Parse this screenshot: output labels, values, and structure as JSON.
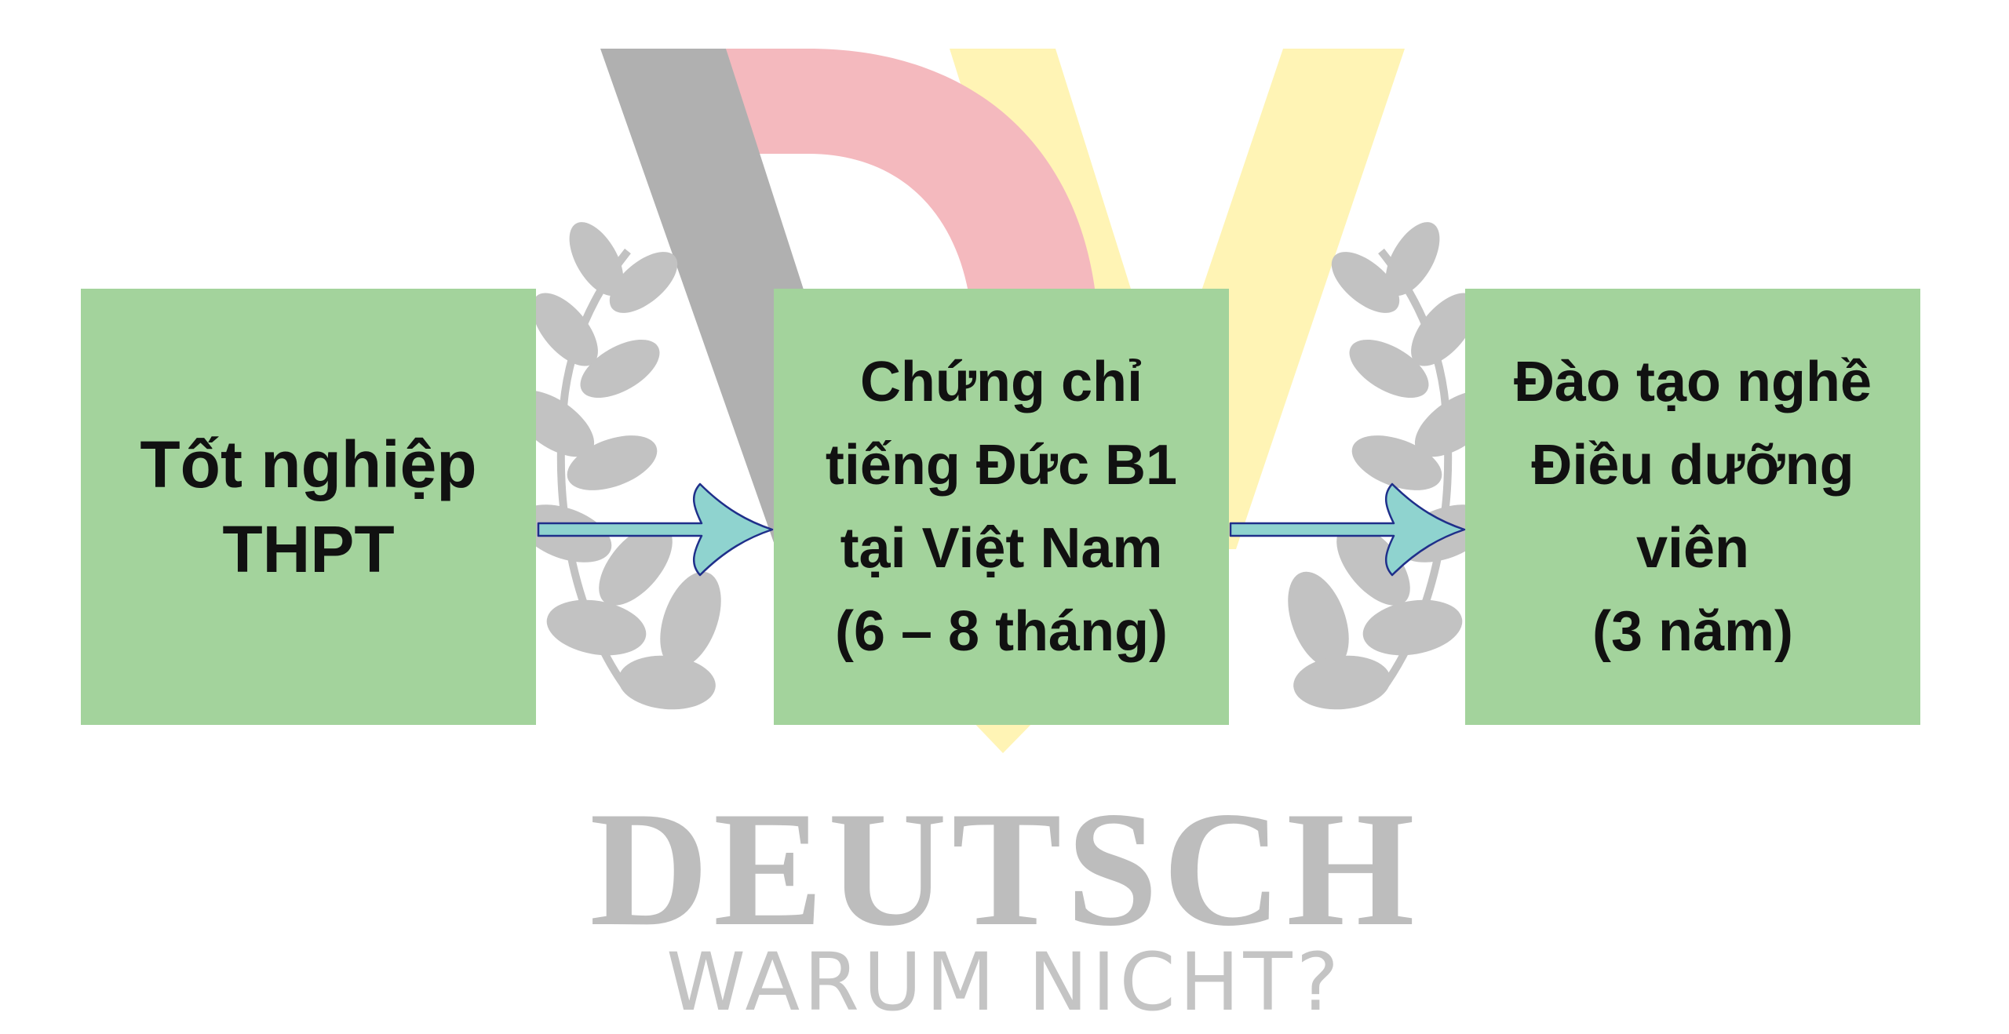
{
  "steps": [
    {
      "lines": [
        "Tốt nghiệp",
        "THPT"
      ]
    },
    {
      "lines": [
        "Chứng chỉ",
        "tiếng Đức B1",
        "tại Việt Nam",
        "(6 – 8 tháng)"
      ]
    },
    {
      "lines": [
        "Đào tạo nghề",
        "Điều dưỡng",
        "viên",
        "(3 năm)"
      ]
    }
  ],
  "watermark": {
    "brand": "DEUTSCH",
    "slogan": "WARUM NICHT?"
  },
  "colors": {
    "box_fill": "#a3d39c",
    "arrow_fill": "#8fd3cf",
    "arrow_stroke": "#1f2f8a",
    "watermark_gray": "#b0b0b0",
    "watermark_red": "#f4b9be",
    "watermark_yellow": "#fff4b5"
  }
}
